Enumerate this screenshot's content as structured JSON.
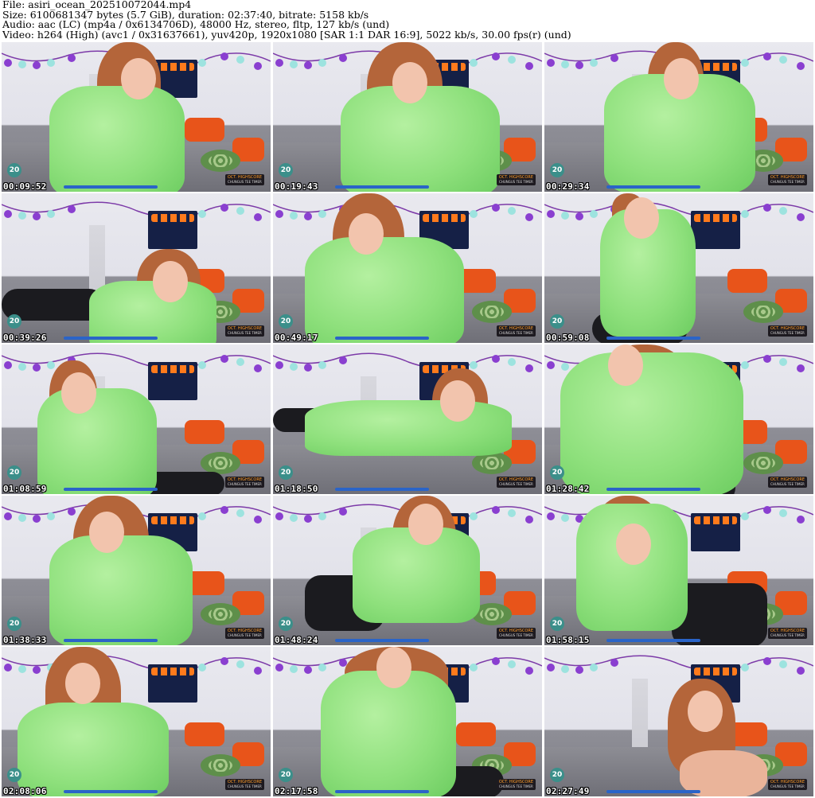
{
  "header": {
    "line1": "File: asiri_ocean_202510072044.mp4",
    "line2": "Size: 6100681347 bytes (5.7 GiB), duration: 02:37:40, bitrate: 5158 kb/s",
    "line3": "Audio: aac (LC) (mp4a / 0x6134706D), 48000 Hz, stereo, fltp, 127 kb/s (und)",
    "line4": "Video: h264 (High) (avc1 / 0x31637661), yuv420p, 1920x1080 [SAR 1:1 DAR 16:9], 5022 kb/s, 30.00 fps(r) (und)"
  },
  "overlay": {
    "counter": "20",
    "badge_line1": "OCT. HIGHSCORE",
    "badge_line2": "CHUNGUS TEE TIMER"
  },
  "thumbnails": [
    {
      "timestamp": "00:09:52"
    },
    {
      "timestamp": "00:19:43"
    },
    {
      "timestamp": "00:29:34"
    },
    {
      "timestamp": "00:39:26"
    },
    {
      "timestamp": "00:49:17"
    },
    {
      "timestamp": "00:59:08"
    },
    {
      "timestamp": "01:08:59"
    },
    {
      "timestamp": "01:18:50"
    },
    {
      "timestamp": "01:28:42"
    },
    {
      "timestamp": "01:38:33"
    },
    {
      "timestamp": "01:48:24"
    },
    {
      "timestamp": "01:58:15"
    },
    {
      "timestamp": "02:08:06"
    },
    {
      "timestamp": "02:17:58"
    },
    {
      "timestamp": "02:27:49"
    }
  ],
  "colors": {
    "costume_green": "#8ee07c",
    "hair": "#b4653a",
    "pillow_orange": "#e8541a",
    "poster_navy": "#152046",
    "timestamp_text": "#ffffff"
  }
}
